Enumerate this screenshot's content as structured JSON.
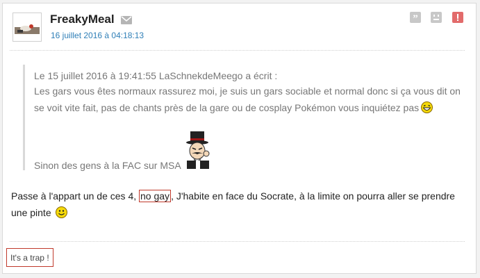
{
  "post": {
    "author": "FreakyMeal",
    "date": "16 juillet 2016 à 04:18:13",
    "actions": [
      {
        "name": "quote-icon",
        "glyph": "quote"
      },
      {
        "name": "sad-face-icon",
        "glyph": "sad-face"
      },
      {
        "name": "alert-icon",
        "glyph": "exclamation"
      }
    ],
    "quote": {
      "header": "Le 15 juillet 2016 à 19:41:55 LaSchnekdeMeego a écrit :",
      "body": "Les gars vous êtes normaux rassurez moi, je suis un gars sociable et normal donc si ça vous dit on se voit vite fait, pas de chants près de la gare ou de cosplay Pokémon vous inquiétez pas",
      "body_smiley": "laughing-smiley-icon",
      "footer": "Sinon des gens à la FAC sur MSA",
      "footer_image": "top-hat-villain-sticker"
    },
    "message": {
      "before": "Passe à l'appart un de ces 4, ",
      "highlighted": "no gay",
      "after": ", J'habite en face du Socrate, à la limite on pourra aller se prendre une pinte",
      "smiley": "smiling-smiley-icon"
    },
    "signature": "It's a trap !"
  },
  "colors": {
    "link_blue": "#2f7fb7",
    "highlight_red": "#c0392b",
    "quote_gray": "#777777",
    "icon_gray": "#c8c8c8",
    "alert_red": "#e26b6b"
  }
}
